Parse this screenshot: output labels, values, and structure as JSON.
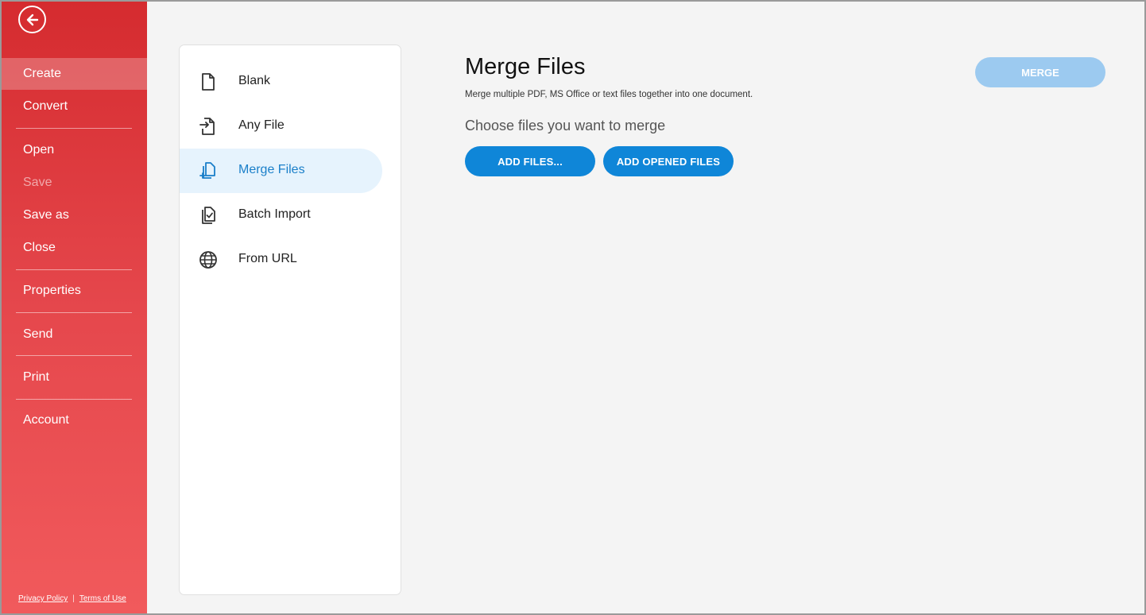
{
  "sidebar": {
    "back_label": "Back",
    "items": [
      {
        "label": "Create"
      },
      {
        "label": "Convert"
      },
      {
        "label": "Open"
      },
      {
        "label": "Save"
      },
      {
        "label": "Save as"
      },
      {
        "label": "Close"
      },
      {
        "label": "Properties"
      },
      {
        "label": "Send"
      },
      {
        "label": "Print"
      },
      {
        "label": "Account"
      }
    ],
    "footer": {
      "privacy": "Privacy Policy",
      "separator": "|",
      "terms": "Terms of Use"
    }
  },
  "panel": {
    "items": [
      {
        "label": "Blank",
        "icon": "blank-file-icon"
      },
      {
        "label": "Any File",
        "icon": "any-file-icon"
      },
      {
        "label": "Merge Files",
        "icon": "merge-files-icon"
      },
      {
        "label": "Batch Import",
        "icon": "batch-import-icon"
      },
      {
        "label": "From URL",
        "icon": "globe-icon"
      }
    ]
  },
  "main": {
    "title": "Merge Files",
    "description": "Merge multiple PDF, MS Office or text files together into one document.",
    "subtitle": "Choose files you want to merge",
    "add_files_label": "ADD FILES...",
    "add_opened_label": "ADD OPENED FILES",
    "merge_label": "MERGE"
  },
  "colors": {
    "sidebar_top": "#d52b2f",
    "sidebar_bottom": "#f15a5c",
    "accent_blue": "#0f86d8",
    "merge_disabled": "#9ccaf0",
    "active_item_bg": "#e6f3fd"
  }
}
